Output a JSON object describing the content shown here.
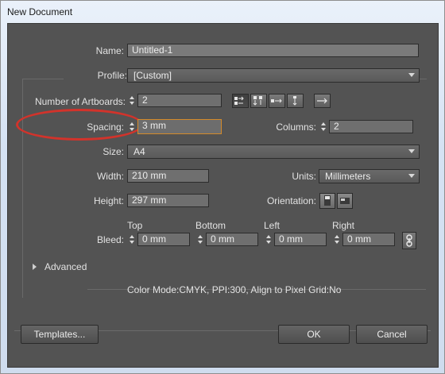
{
  "window": {
    "title": "New Document"
  },
  "name": {
    "label": "Name:",
    "value": "Untitled-1"
  },
  "profile": {
    "label": "Profile:",
    "value": "[Custom]"
  },
  "artboards": {
    "label": "Number of Artboards:",
    "value": "2"
  },
  "spacing": {
    "label": "Spacing:",
    "value": "3 mm"
  },
  "columns": {
    "label": "Columns:",
    "value": "2"
  },
  "size": {
    "label": "Size:",
    "value": "A4"
  },
  "width": {
    "label": "Width:",
    "value": "210 mm"
  },
  "units": {
    "label": "Units:",
    "value": "Millimeters"
  },
  "height": {
    "label": "Height:",
    "value": "297 mm"
  },
  "orientation": {
    "label": "Orientation:"
  },
  "bleed": {
    "label": "Bleed:",
    "top_label": "Top",
    "top": "0 mm",
    "bottom_label": "Bottom",
    "bottom": "0 mm",
    "left_label": "Left",
    "left": "0 mm",
    "right_label": "Right",
    "right": "0 mm"
  },
  "advanced": {
    "label": "Advanced"
  },
  "info": {
    "text": "Color Mode:CMYK, PPI:300, Align to Pixel Grid:No"
  },
  "buttons": {
    "templates": "Templates...",
    "ok": "OK",
    "cancel": "Cancel"
  },
  "colors": {
    "panel": "#535353",
    "field": "#6f6f6f",
    "focus": "#d48a2a",
    "annotation": "#d2332b"
  },
  "icons": [
    "grid-by-row-icon",
    "grid-by-column-icon",
    "arrange-by-row-icon",
    "arrange-by-column-icon",
    "right-to-left-icon",
    "link-icon",
    "portrait-icon",
    "landscape-icon"
  ]
}
